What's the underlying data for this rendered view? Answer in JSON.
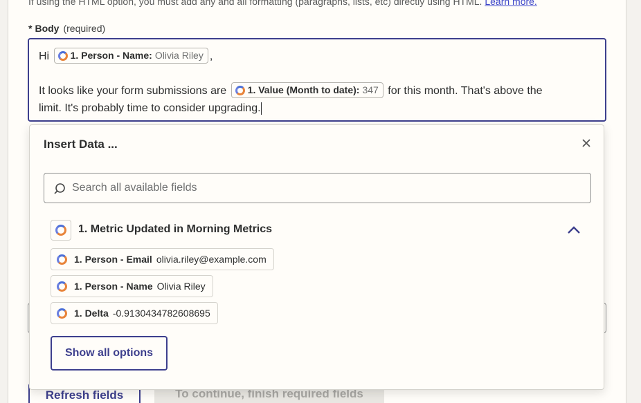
{
  "help": {
    "text": "If using the HTML option, you must add any and all formatting (paragraphs, lists, etc) directly using HTML.",
    "link": "Learn more."
  },
  "field": {
    "star": "*",
    "name": "Body",
    "required": "(required)"
  },
  "body": {
    "greeting": "Hi",
    "pill1": {
      "label": "1. Person - Name:",
      "value": "Olivia Riley"
    },
    "comma": ",",
    "line2_pre": "It looks like your form submissions are",
    "pill2": {
      "label": "1. Value (Month to date):",
      "value": "347"
    },
    "line2_post": "for this month. That's above the",
    "line3": "limit. It's probably time to consider upgrading."
  },
  "insert": {
    "title": "Insert Data ...",
    "close_icon": "close-icon",
    "search_placeholder": "Search all available fields",
    "group_title": "1. Metric Updated in Morning Metrics",
    "options": [
      {
        "label": "1. Person - Email",
        "value": "olivia.riley@example.com"
      },
      {
        "label": "1. Person - Name",
        "value": "Olivia Riley"
      },
      {
        "label": "1. Delta",
        "value": "-0.9130434782608695"
      }
    ],
    "show_all": "Show all options"
  },
  "footer": {
    "refresh": "Refresh fields",
    "continue": "To continue, finish required fields"
  },
  "colors": {
    "accent": "#3d3f8d",
    "logo_orange": "#e8843a",
    "logo_blue": "#4b6fd8"
  }
}
